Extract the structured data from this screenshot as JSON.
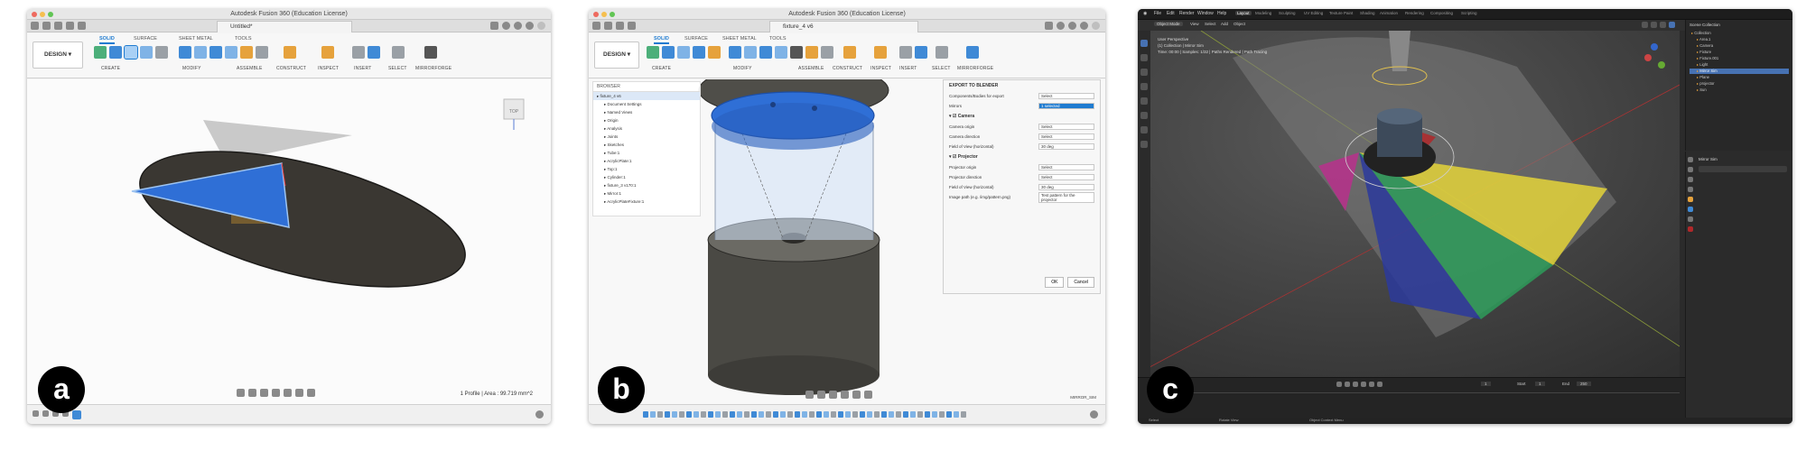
{
  "labels": {
    "a": "a",
    "b": "b",
    "c": "c"
  },
  "panel_a": {
    "window_title": "Autodesk Fusion 360 (Education License)",
    "doc_tab": "Untitled*",
    "design_label": "DESIGN",
    "tabs": [
      "SOLID",
      "SURFACE",
      "SHEET METAL",
      "TOOLS"
    ],
    "groups": [
      "CREATE",
      "MODIFY",
      "ASSEMBLE",
      "CONSTRUCT",
      "INSPECT",
      "INSERT",
      "SELECT",
      "MIRRORFORGE"
    ],
    "status_text": "1 Profile | Area : 99.719 mm^2",
    "colors": {
      "blue_face": "#2f6fd6",
      "disk": "#3a3732"
    }
  },
  "panel_b": {
    "window_title": "Autodesk Fusion 360 (Education License)",
    "doc_tab": "fixture_4 v6",
    "design_label": "DESIGN",
    "tabs": [
      "SOLID",
      "SURFACE",
      "SHEET METAL",
      "TOOLS"
    ],
    "groups": [
      "CREATE",
      "MODIFY",
      "ASSEMBLE",
      "CONSTRUCT",
      "INSPECT",
      "INSERT",
      "SELECT",
      "MIRRORFORGE"
    ],
    "browser_title": "BROWSER",
    "browser_items": [
      "fixture_4 v6",
      "Document Settings",
      "Named Views",
      "Origin",
      "Analysis",
      "Joints",
      "Sketches",
      "Tube:1",
      "AcrylicPlate:1",
      "Top:1",
      "Cylinder:1",
      "fixture_3 v170:1",
      "Mirror:1",
      "AcrylicPlateFixture:1"
    ],
    "dialog": {
      "title": "EXPORT TO BLENDER",
      "rows": [
        {
          "label": "Components/Bodies for export",
          "value": "Select"
        },
        {
          "label": "Mirrors",
          "value": "1 selected"
        }
      ],
      "camera_header": "Camera",
      "camera_rows": [
        {
          "label": "Camera origin",
          "value": "Select"
        },
        {
          "label": "Camera direction",
          "value": "Select"
        },
        {
          "label": "Field of View (horizontal)",
          "value": "30 deg"
        }
      ],
      "projector_header": "Projector",
      "projector_rows": [
        {
          "label": "Projector origin",
          "value": "Select"
        },
        {
          "label": "Projector direction",
          "value": "Select"
        },
        {
          "label": "Field of View (horizontal)",
          "value": "30 deg"
        },
        {
          "label": "Image path (e.g. /img/pattern.png)",
          "value": "Test pattern for the projector"
        }
      ],
      "ok": "OK",
      "cancel": "Cancel"
    },
    "view_label": "MIRROR_SIM",
    "colors": {
      "blue_plate": "#2f6fd6",
      "body": "#4a4944"
    }
  },
  "panel_c": {
    "menus": [
      "File",
      "Edit",
      "Render",
      "Window",
      "Help"
    ],
    "workspaces": [
      "Layout",
      "Modeling",
      "Sculpting",
      "UV Editing",
      "Texture Paint",
      "Shading",
      "Animation",
      "Rendering",
      "Compositing",
      "Scripting"
    ],
    "viewport_info": {
      "line1": "User Perspective",
      "line2": "(1) Collection | Mirror Sim",
      "line3": "Time: 00:00 | Samples: 1/32 | Paths Rendered | Path Tracing"
    },
    "mode_label": "Object Mode",
    "header_menus": [
      "View",
      "Select",
      "Add",
      "Object"
    ],
    "outliner_title": "Scene Collection",
    "outliner_items": [
      "Collection",
      "Area.1",
      "Camera",
      "Fixture",
      "Fixture.001",
      "Light",
      "Mirror Sim",
      "Plane",
      "projector",
      "Sun"
    ],
    "outliner_selected": "Mirror Sim",
    "timeline": {
      "start_label": "Start",
      "start": "1",
      "end_label": "End",
      "end": "250",
      "current": "1"
    },
    "status_left": "Select",
    "status_mid": "Rotate View",
    "status_right": "Object Context Menu",
    "props_label": "Mirror Sim",
    "colors": {
      "yellow": "#e4d33a",
      "green": "#2e9c5a",
      "blue": "#2b3a9c",
      "magenta": "#b9308c",
      "red": "#b0282a"
    }
  }
}
